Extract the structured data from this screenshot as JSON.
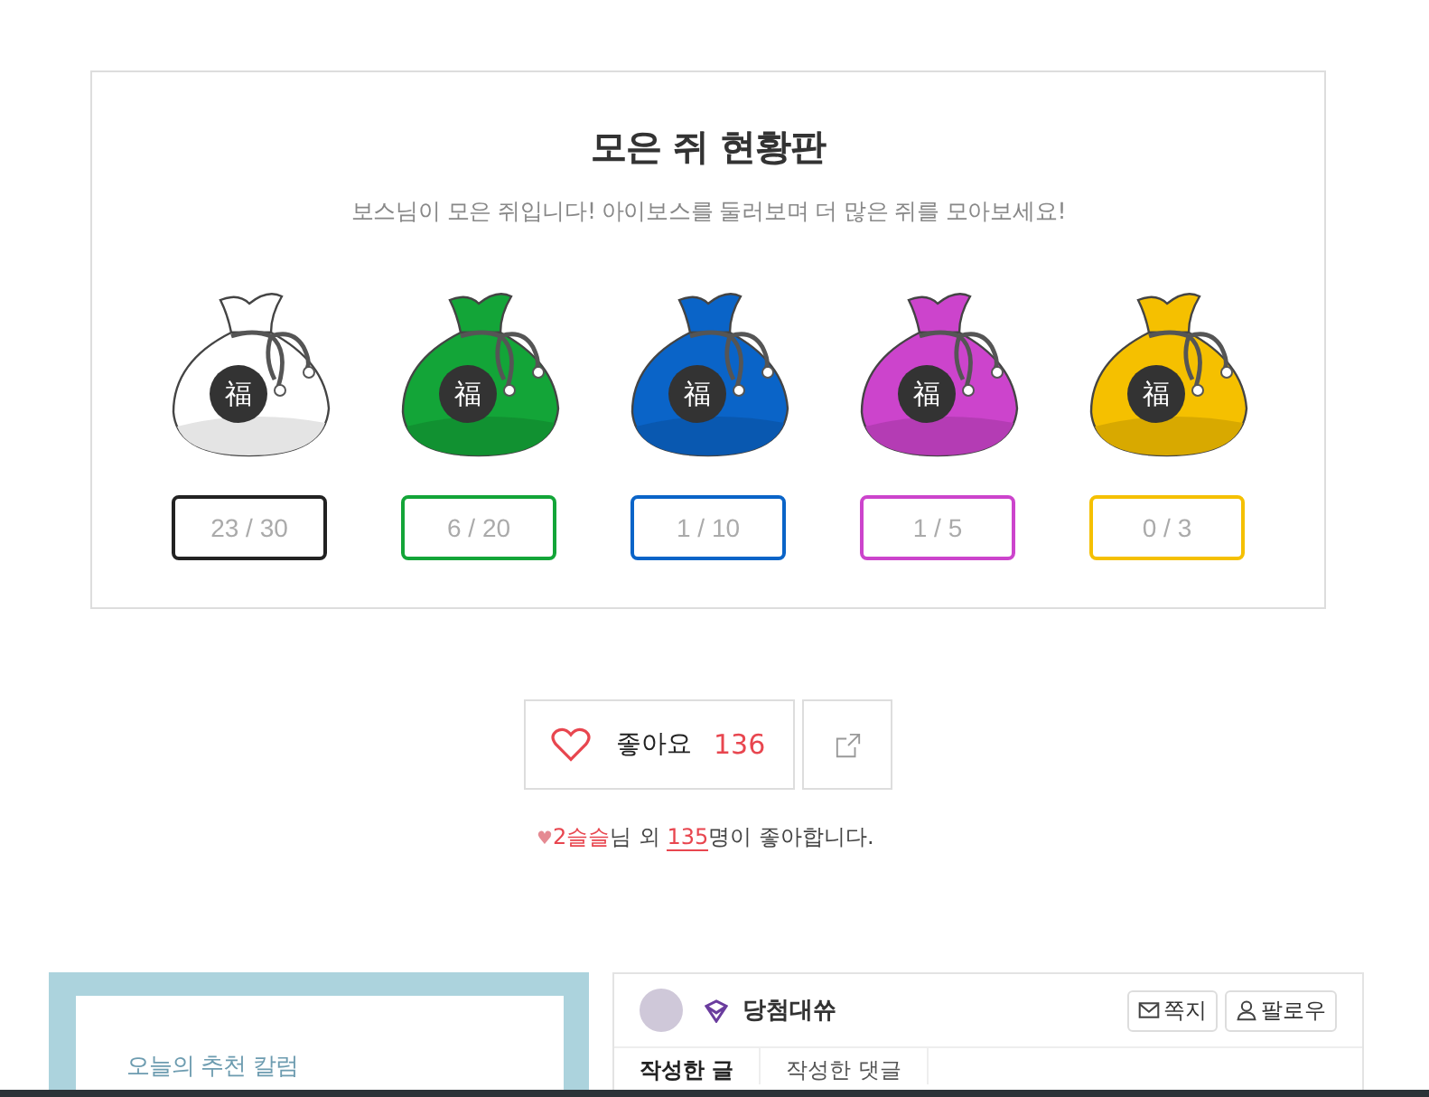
{
  "board": {
    "title": "모은 쥐 현황판",
    "subtitle": "보스님이 모은 쥐입니다! 아이보스를 둘러보며 더 많은 쥐를 모아보세요!",
    "bags": [
      {
        "color": "#ffffff",
        "glyph": "福",
        "count": "23 / 30"
      },
      {
        "color": "#13a538",
        "glyph": "福",
        "count": "6 / 20"
      },
      {
        "color": "#0a64c8",
        "glyph": "福",
        "count": "1 / 10"
      },
      {
        "color": "#cc44cc",
        "glyph": "福",
        "count": "1 / 5"
      },
      {
        "color": "#f5c000",
        "glyph": "福",
        "count": "0 / 3"
      }
    ]
  },
  "like": {
    "label": "좋아요",
    "count": "136",
    "liked": false
  },
  "liked_by": {
    "heart": "♥",
    "user": "2슬슬",
    "text1": "님 외 ",
    "others": "135",
    "text2": "명이 좋아합니다."
  },
  "column_card": {
    "title": "오늘의 추천 칼럼"
  },
  "profile": {
    "name": "당첨대쓔",
    "buttons": [
      {
        "kind": "message",
        "label": "쪽지"
      },
      {
        "kind": "follow",
        "label": "팔로우"
      }
    ],
    "tabs": [
      {
        "label": "작성한 글",
        "selected": true
      },
      {
        "label": "작성한 댓글",
        "selected": false
      }
    ]
  }
}
